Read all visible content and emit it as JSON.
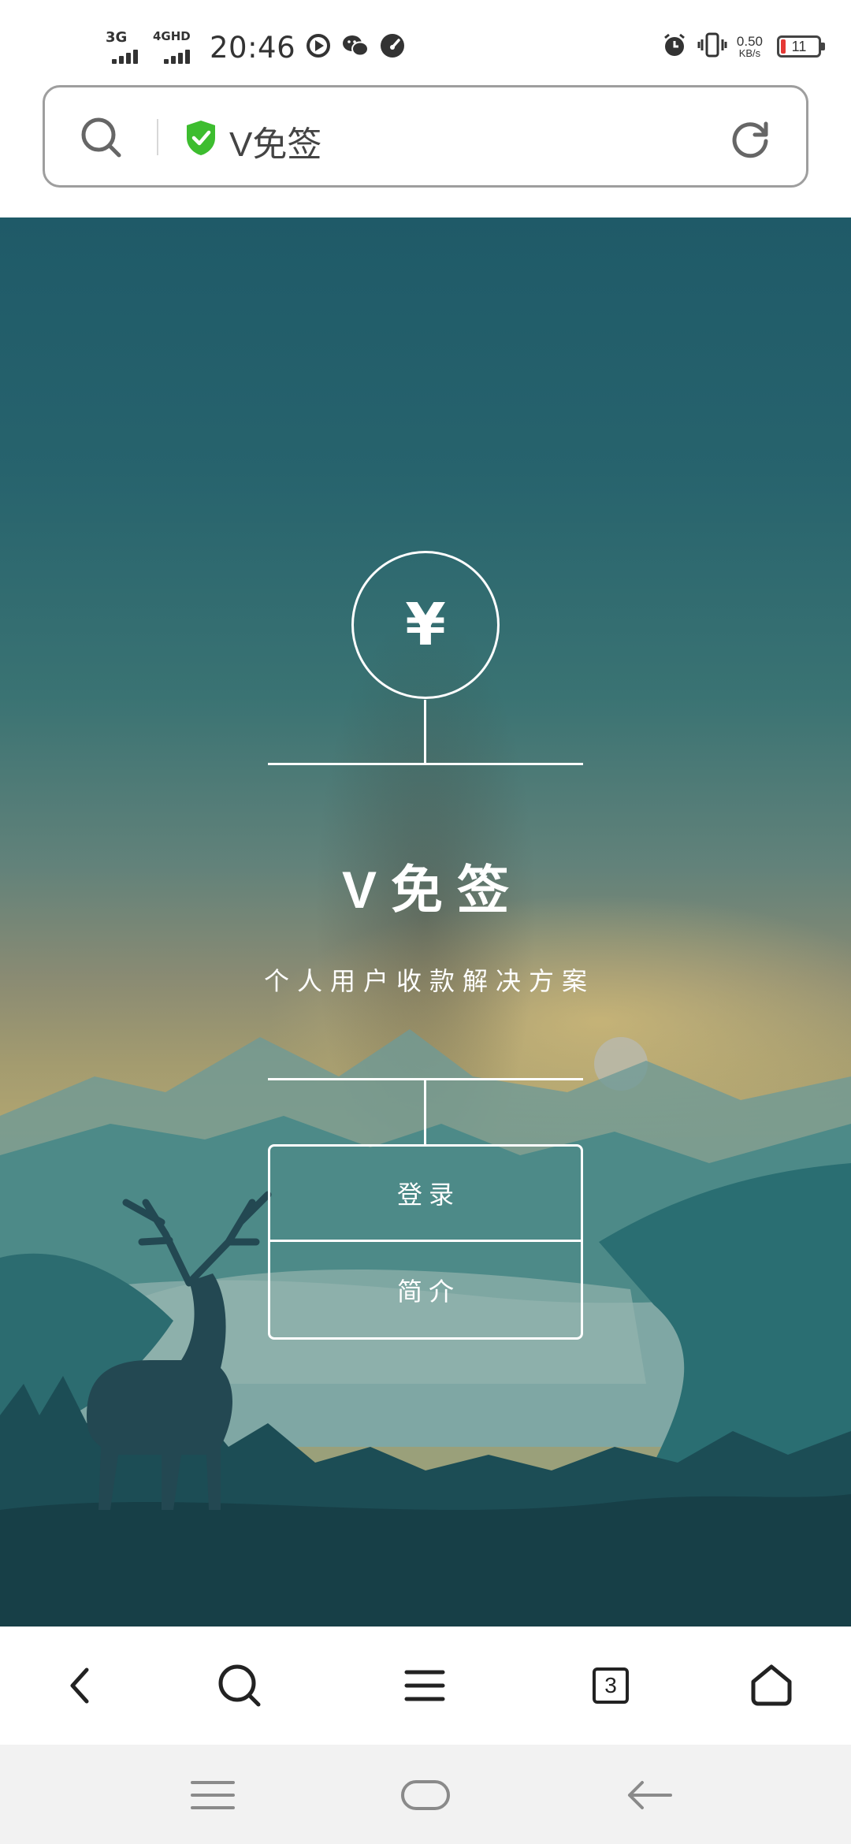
{
  "status_bar": {
    "network_1": "3G",
    "network_2": "4GHD",
    "time": "20:46",
    "speed_value": "0.50",
    "speed_unit": "KB/s",
    "battery_level": "11",
    "icons": [
      "play-icon",
      "wechat-icon",
      "speedometer-icon",
      "alarm-icon",
      "vibrate-icon"
    ]
  },
  "address_bar": {
    "title": "V免签",
    "secure": true
  },
  "hero": {
    "logo_symbol": "¥",
    "brand_title": "V免签",
    "subtitle": "个人用户收款解决方案",
    "buttons": {
      "login": "登录",
      "intro": "简介"
    }
  },
  "toolbar": {
    "tabs_count": "3",
    "items": [
      "back-icon",
      "search-icon",
      "menu-icon",
      "tabs-icon",
      "home-icon"
    ]
  },
  "system_nav": {
    "items": [
      "recent-apps-icon",
      "home-pill-icon",
      "system-back-icon"
    ]
  },
  "colors": {
    "secure_green": "#3dbd2f",
    "battery_low": "#e53935",
    "hero_top": "#1f5a68",
    "hero_sunset": "#b2a671"
  }
}
